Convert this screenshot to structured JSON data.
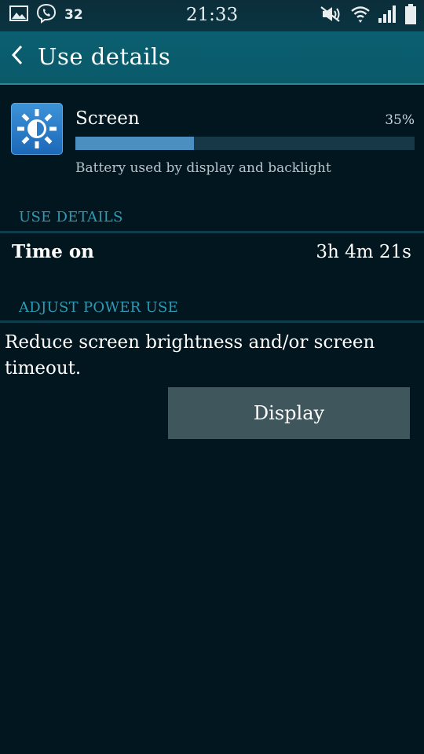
{
  "status_bar": {
    "time": "21:33",
    "notification_count": "32",
    "icons": [
      "gallery-icon",
      "viber-icon",
      "mute-icon",
      "wifi-icon",
      "signal-icon",
      "battery-icon"
    ]
  },
  "app_bar": {
    "title": "Use details",
    "back_icon": "chevron-left-icon"
  },
  "item": {
    "name": "Screen",
    "percent": "35%",
    "fraction": 0.35,
    "description": "Battery used by display and backlight",
    "icon": "brightness-icon"
  },
  "sections": {
    "use_details": "USE DETAILS",
    "adjust_power": "ADJUST POWER USE"
  },
  "time_on": {
    "label": "Time on",
    "value": "3h 4m 21s"
  },
  "advice": "Reduce screen brightness and/or screen timeout.",
  "display_button": "Display",
  "colors": {
    "background": "#02161f",
    "app_bar": "#0b5f70",
    "section_header": "#2d9bb5",
    "bar_fill": "#4a8fbf",
    "button": "#3e565c"
  }
}
